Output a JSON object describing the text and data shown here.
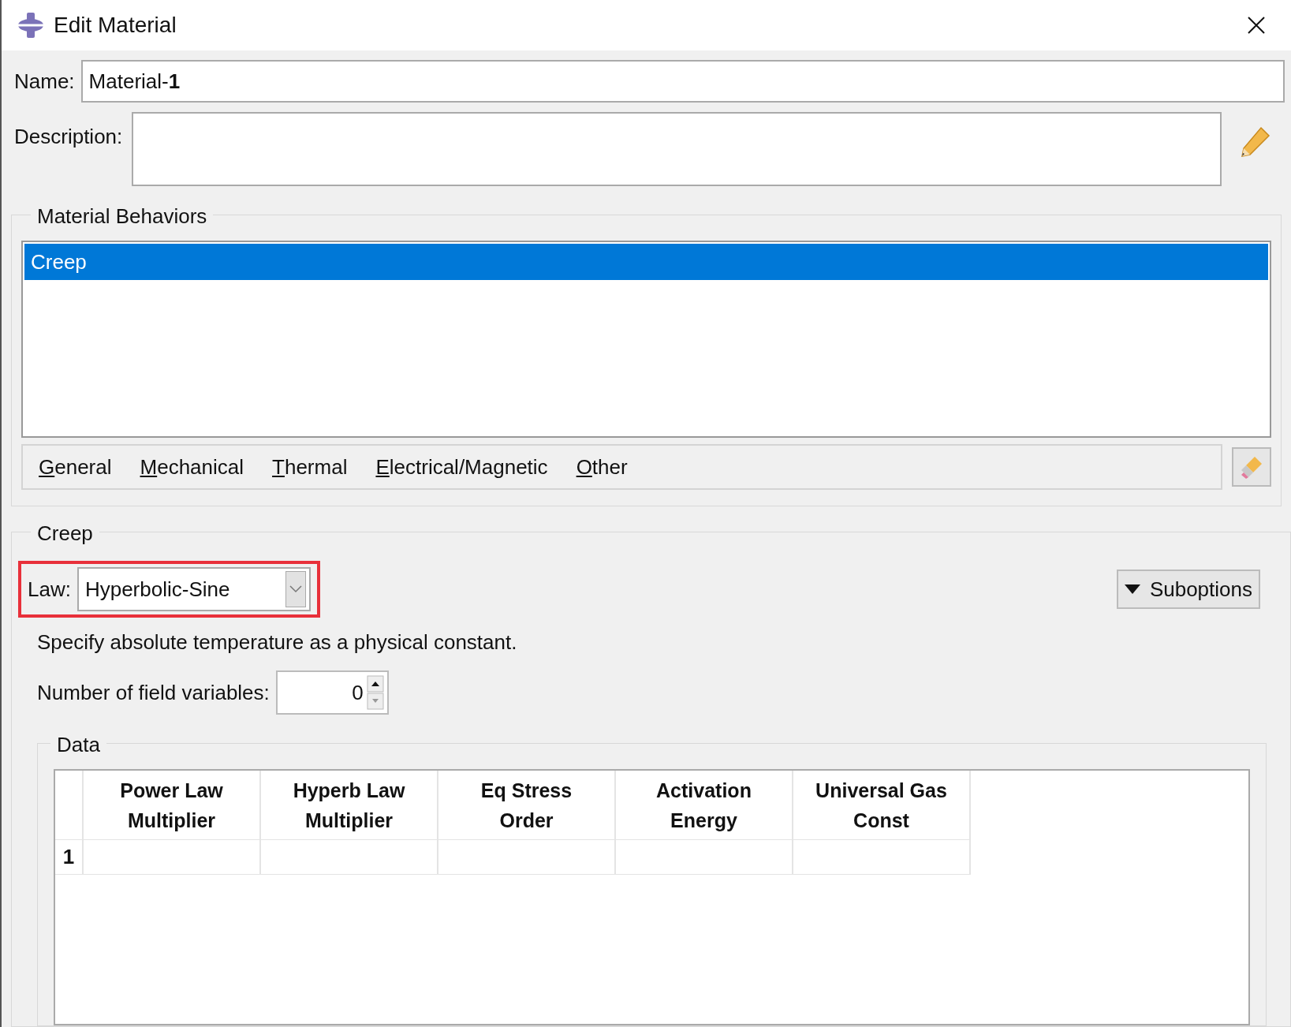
{
  "window": {
    "title": "Edit Material"
  },
  "name_field": {
    "label": "Name:",
    "value": "Material-**1**"
  },
  "description_field": {
    "label": "Description:"
  },
  "material_behaviors": {
    "title": "Material Behaviors",
    "items": [
      {
        "label": "Creep",
        "selected": true
      }
    ]
  },
  "menu": [
    "General",
    "Mechanical",
    "Thermal",
    "Electrical/Magnetic",
    "Other"
  ],
  "creep": {
    "title": "Creep",
    "law": {
      "label": "Law:",
      "value": "Hyperbolic-Sine",
      "highlighted": true
    },
    "suboptions": "Suboptions",
    "note": "Specify absolute temperature as a physical constant.",
    "field_variables": {
      "label": "Number of field variables:",
      "value": "0"
    }
  },
  "data": {
    "title": "Data",
    "columns": [
      "Power Law Multiplier",
      "Hyperb Law Multiplier",
      "Eq Stress Order",
      "Activation Energy",
      "Universal Gas Const"
    ],
    "rows": [
      {
        "label": "1"
      }
    ]
  }
}
